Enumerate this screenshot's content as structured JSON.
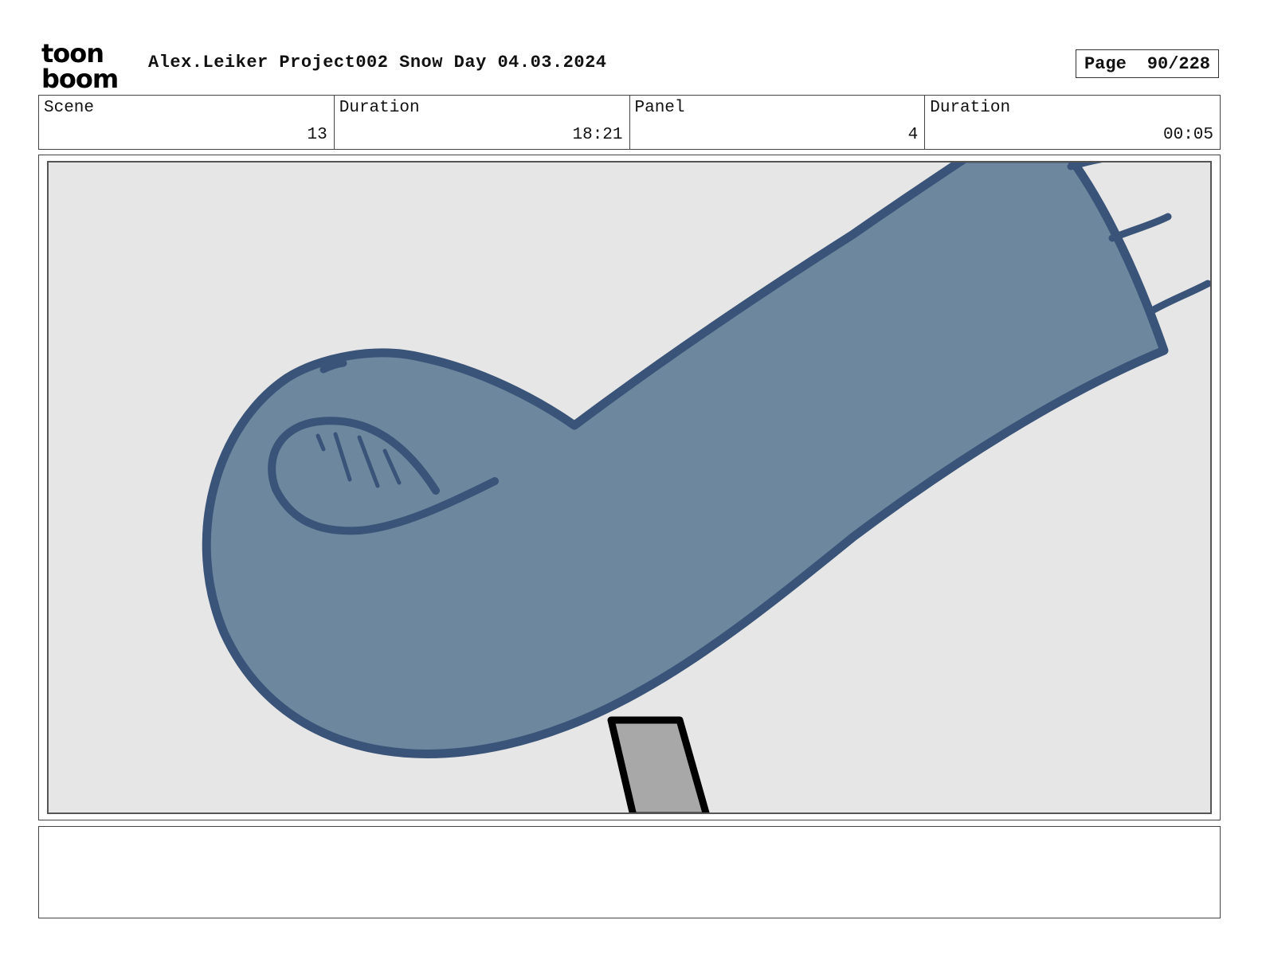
{
  "header": {
    "logo_line1": "toon",
    "logo_line2": "boom",
    "title": "Alex.Leiker Project002 Snow Day 04.03.2024",
    "page_label": "Page",
    "page_value": "90/228"
  },
  "info": {
    "scene_label": "Scene",
    "scene_value": "13",
    "scene_duration_label": "Duration",
    "scene_duration_value": "18:21",
    "panel_label": "Panel",
    "panel_value": "4",
    "panel_duration_label": "Duration",
    "panel_duration_value": "00:05"
  },
  "panel_art": {
    "background_color": "#e6e6e6",
    "arm_fill_color": "#6d889e",
    "arm_outline_color": "#3a5479",
    "pole_fill_color": "#a8a8a8",
    "pole_outline_color": "#000000"
  },
  "notes": {
    "text": ""
  }
}
